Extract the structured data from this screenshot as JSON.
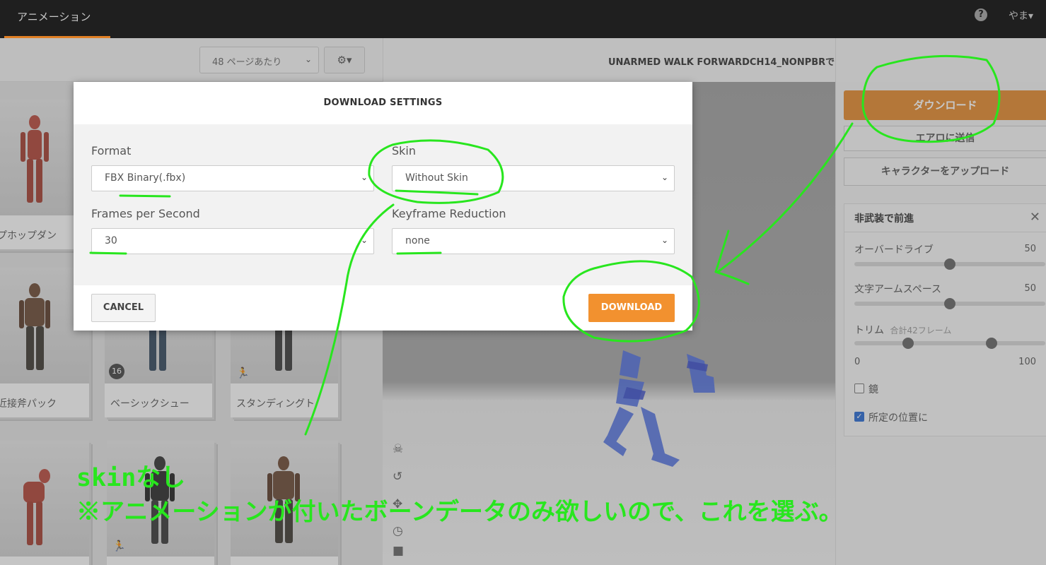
{
  "topbar": {
    "nav_animations": "アニメーション",
    "help_glyph": "?",
    "user": "やま▾"
  },
  "toolbar": {
    "per_page": "48 ページあたり",
    "settings_glyph": "⚙▾"
  },
  "cards": [
    {
      "label": "ップホップダン"
    },
    {
      "label": ""
    },
    {
      "label": ""
    },
    {
      "label": "ロ近接斧パック"
    },
    {
      "label": "ベーシックシュー",
      "badge": "16"
    },
    {
      "label": "スタンディングト"
    }
  ],
  "viewer": {
    "title": "UNARMED WALK FORWARDCH14_NONPBRで"
  },
  "right_panel": {
    "download": "ダウンロード",
    "send": "エアロに送信",
    "upload": "キャラクターをアップロード",
    "anim_title": "非武装で前進",
    "close_glyph": "✕",
    "overdrive_label": "オーバードライブ",
    "overdrive_value": "50",
    "overdrive_level": 50,
    "armspace_label": "文字アームスペース",
    "armspace_value": "50",
    "armspace_level": 50,
    "trim_label": "トリム",
    "trim_sub": "合計42フレーム",
    "trim_min": "0",
    "trim_max": "100",
    "trim_range": [
      28,
      72
    ],
    "mirror_label": "鏡",
    "mirror_checked": false,
    "inplace_label": "所定の位置に",
    "inplace_checked": true
  },
  "modal": {
    "title": "DOWNLOAD SETTINGS",
    "format_label": "Format",
    "format_value": "FBX Binary(.fbx)",
    "skin_label": "Skin",
    "skin_value": "Without Skin",
    "fps_label": "Frames per Second",
    "fps_value": "30",
    "keyframe_label": "Keyframe Reduction",
    "keyframe_value": "none",
    "cancel": "CANCEL",
    "download": "DOWNLOAD"
  },
  "annotation": {
    "line1": "skinなし",
    "line2": "※アニメーションが付いたボーンデータのみ欲しいので、これを選ぶ。",
    "color": "#28e61e"
  },
  "colors": {
    "accent": "#f2912f",
    "topbar": "#1f1f1f"
  }
}
